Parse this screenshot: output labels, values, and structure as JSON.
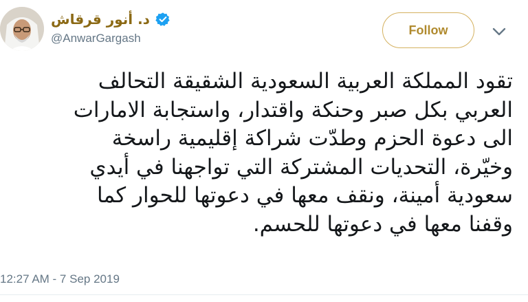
{
  "author": {
    "display_name": "د. أنور قرقاش",
    "handle": "@AnwarGargash",
    "verified": true
  },
  "actions": {
    "follow_label": "Follow"
  },
  "tweet": {
    "lines": [
      "تقود المملكة العربية السعودية الشقيقة التحالف",
      "العربي بكل صبر وحنكة واقتدار، واستجابة الامارات",
      "الى دعوة الحزم وطدّت شراكة إقليمية راسخة",
      "وخيّرة، التحديات المشتركة التي تواجهنا في أيدي",
      "سعودية أمينة، ونقف معها في دعوتها للحوار كما",
      "وقفنا معها في دعوتها للحسم."
    ],
    "timestamp": "12:27 AM - 7 Sep 2019"
  },
  "colors": {
    "brand_gold": "#b08a2e",
    "verified_blue": "#1da1f2",
    "secondary_text": "#657786"
  },
  "icons": [
    "verified-badge-icon",
    "chevron-down-icon"
  ]
}
